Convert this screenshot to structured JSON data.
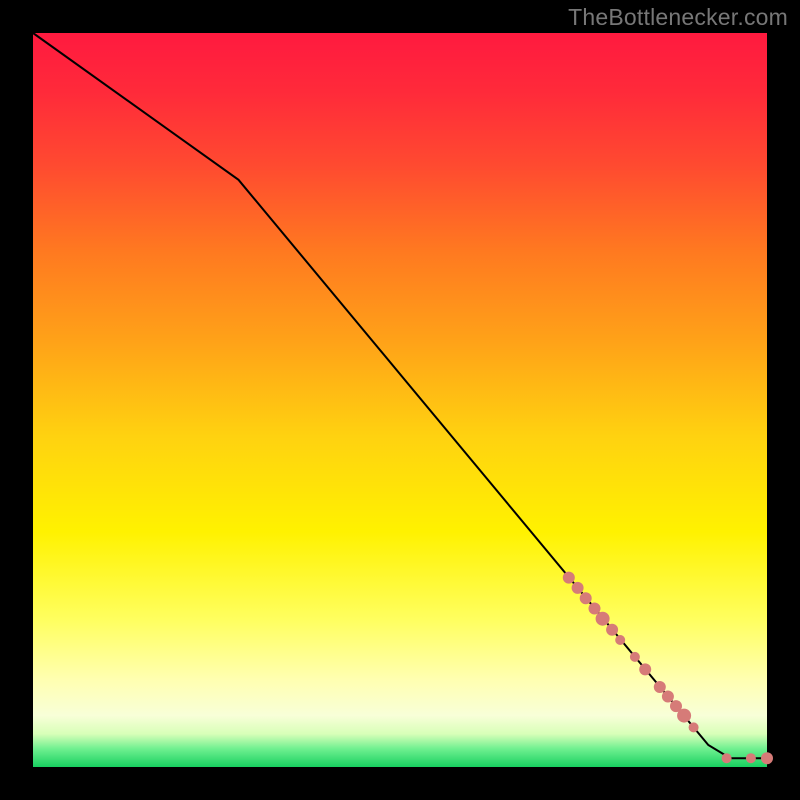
{
  "attribution": "TheBottlenecker.com",
  "colors": {
    "frame": "#000000",
    "curve": "#000000",
    "marker": "#d67b78",
    "gradient_stops": [
      {
        "offset": 0.0,
        "color": "#ff1a3f"
      },
      {
        "offset": 0.08,
        "color": "#ff2a3a"
      },
      {
        "offset": 0.18,
        "color": "#ff4a30"
      },
      {
        "offset": 0.3,
        "color": "#ff7a20"
      },
      {
        "offset": 0.42,
        "color": "#ffa218"
      },
      {
        "offset": 0.55,
        "color": "#ffd210"
      },
      {
        "offset": 0.68,
        "color": "#fff200"
      },
      {
        "offset": 0.8,
        "color": "#ffff60"
      },
      {
        "offset": 0.88,
        "color": "#ffffb0"
      },
      {
        "offset": 0.93,
        "color": "#f8ffd8"
      },
      {
        "offset": 0.955,
        "color": "#d8ffb8"
      },
      {
        "offset": 0.975,
        "color": "#70f090"
      },
      {
        "offset": 1.0,
        "color": "#18d060"
      }
    ]
  },
  "chart_data": {
    "type": "line",
    "title": "",
    "xlabel": "",
    "ylabel": "",
    "xlim": [
      0,
      100
    ],
    "ylim": [
      0,
      100
    ],
    "curve": [
      {
        "x": 0,
        "y": 100
      },
      {
        "x": 28,
        "y": 80
      },
      {
        "x": 92,
        "y": 3
      },
      {
        "x": 95,
        "y": 1.2
      },
      {
        "x": 100,
        "y": 1.2
      }
    ],
    "series": [
      {
        "name": "data-points",
        "points": [
          {
            "x": 73.0,
            "y": 25.8,
            "r": 6
          },
          {
            "x": 74.2,
            "y": 24.4,
            "r": 6
          },
          {
            "x": 75.3,
            "y": 23.0,
            "r": 6
          },
          {
            "x": 76.5,
            "y": 21.6,
            "r": 6
          },
          {
            "x": 77.6,
            "y": 20.2,
            "r": 7
          },
          {
            "x": 78.9,
            "y": 18.7,
            "r": 6
          },
          {
            "x": 80.0,
            "y": 17.3,
            "r": 5
          },
          {
            "x": 82.0,
            "y": 15.0,
            "r": 5
          },
          {
            "x": 83.4,
            "y": 13.3,
            "r": 6
          },
          {
            "x": 85.4,
            "y": 10.9,
            "r": 6
          },
          {
            "x": 86.5,
            "y": 9.6,
            "r": 6
          },
          {
            "x": 87.6,
            "y": 8.3,
            "r": 6
          },
          {
            "x": 88.7,
            "y": 7.0,
            "r": 7
          },
          {
            "x": 90.0,
            "y": 5.4,
            "r": 5
          },
          {
            "x": 94.5,
            "y": 1.2,
            "r": 5
          },
          {
            "x": 97.8,
            "y": 1.2,
            "r": 5
          },
          {
            "x": 100.0,
            "y": 1.2,
            "r": 6
          }
        ]
      }
    ]
  }
}
